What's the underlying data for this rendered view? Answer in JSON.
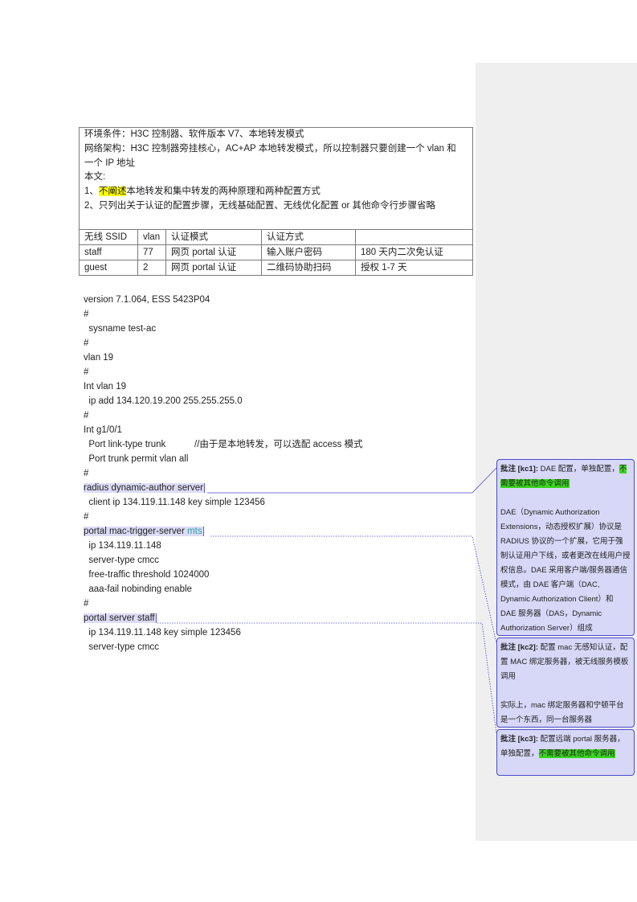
{
  "env_box": {
    "line1": "环境条件：H3C 控制器、软件版本 V7、本地转发模式",
    "line2": "网络架构：H3C 控制器旁挂核心，AC+AP 本地转发模式，所以控制器只要创建一个 vlan 和",
    "line3": "一个 IP 地址",
    "line4": "本文:",
    "line5_prefix": "1、",
    "line5_highlight": "不阐述",
    "line5_rest": "本地转发和集中转发的两种原理和两种配置方式",
    "line6": "2、只列出关于认证的配置步骤，无线基础配置、无线优化配置 or 其他命令行步骤省略"
  },
  "table": {
    "header": [
      "无线 SSID",
      "vlan",
      "认证模式",
      "认证方式",
      ""
    ],
    "rows": [
      [
        "staff",
        "77",
        "网页 portal 认证",
        "输入账户密码",
        "180 天内二次免认证"
      ],
      [
        "guest",
        "2",
        "网页 portal 认证",
        "二维码协助扫码",
        "授权 1-7 天"
      ]
    ]
  },
  "config": {
    "l1": "version 7.1.064, ESS 5423P04",
    "l2": "#",
    "l3": "  sysname test-ac",
    "l4": "#",
    "l5": "vlan 19",
    "l6": "#",
    "l7": "Int vlan 19",
    "l8": "  ip add 134.120.19.200 255.255.255.0",
    "l9": "#",
    "l10": "Int g1/0/1",
    "l11": "  Port link-type trunk",
    "l11_comment": "//由于是本地转发，可以选配 access 模式",
    "l12": "  Port trunk permit vlan all",
    "l13": "#",
    "l14": "radius dynamic-author server",
    "l15": "  client ip 134.119.11.148 key simple 123456",
    "l16": "#",
    "l17_a": "portal mac-trigger-server ",
    "l17_b": "mts",
    "l18": "  ip 134.119.11.148",
    "l19": "  server-type cmcc",
    "l20": "  free-traffic threshold 1024000",
    "l21": "  aaa-fail nobinding enable",
    "l22": "#",
    "l23": "portal server staff",
    "l24": "  ip 134.119.11.148 key simple 123456",
    "l25": "  server-type cmcc"
  },
  "comments": {
    "kc1": {
      "label": "批注 [kc1]:",
      "text_a": " DAE 配置，单独配置，",
      "text_hl1": "不",
      "text_hl2": "需要被其他命令调用",
      "body": "DAE（Dynamic Authorization Extensions，动态授权扩展）协议是 RADIUS 协议的一个扩展，它用于强制认证用户下线，或者更改在线用户授权信息。DAE 采用客户端/服务器通信模式，由 DAE 客户端（DAC, Dynamic Authorization Client）和 DAE 服务器（DAS，Dynamic Authorization Server）组成"
    },
    "kc2": {
      "label": "批注 [kc2]:",
      "text": " 配置 mac 无感知认证，配置 MAC 绑定服务器，被无线服务模板调用",
      "body": "实际上，mac 绑定服务器和宁顿平台是一个东西，同一台服务器"
    },
    "kc3": {
      "label": "批注 [kc3]:",
      "text_a": " 配置远端 portal 服务器，单独配置，",
      "text_hl": "不需要被其他命令调用"
    }
  },
  "colors": {
    "highlight_yellow": "#ffff00",
    "highlight_green": "#39d51f",
    "comment_fill": "#d7d7f7",
    "comment_border": "#4a4ad0",
    "mts_text": "#2f9ea4",
    "margin_pane": "#efefef"
  }
}
